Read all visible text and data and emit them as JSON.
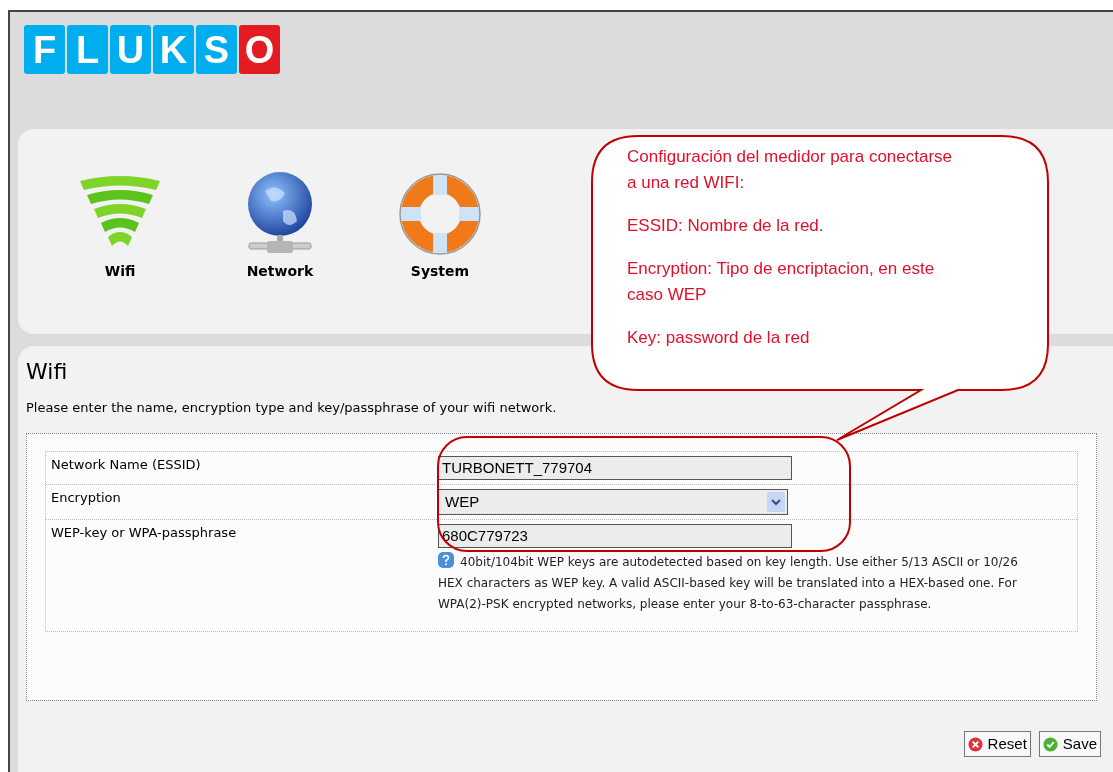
{
  "logo": {
    "letters": [
      {
        "char": "F",
        "color": "#00aeef"
      },
      {
        "char": "L",
        "color": "#00aeef"
      },
      {
        "char": "U",
        "color": "#00aeef"
      },
      {
        "char": "K",
        "color": "#00aeef"
      },
      {
        "char": "S",
        "color": "#00aeef"
      },
      {
        "char": "O",
        "color": "#e31b23"
      }
    ]
  },
  "nav": [
    {
      "kind": "wifi",
      "label": "Wifi"
    },
    {
      "kind": "network",
      "label": "Network"
    },
    {
      "kind": "system",
      "label": "System"
    }
  ],
  "section": {
    "title": "Wifi",
    "description": "Please enter the name, encryption type and key/passphrase of your wifi network."
  },
  "fields": [
    {
      "kind": "text",
      "label": "Network Name (ESSID)",
      "value": "TURBONETT_779704"
    },
    {
      "kind": "select",
      "label": "Encryption",
      "value": "WEP"
    },
    {
      "kind": "text",
      "label": "WEP-key or WPA-passphrase",
      "value": "680C779723",
      "help": "40bit/104bit WEP keys are autodetected based on key length. Use either 5/13 ASCII or 10/26 HEX characters as WEP key. A valid ASCII-based key will be translated into a HEX-based one. For WPA(2)-PSK encrypted networks, please enter your 8-to-63-character passphrase."
    }
  ],
  "buttons": [
    {
      "kind": "reset",
      "label": "Reset"
    },
    {
      "kind": "save",
      "label": "Save"
    }
  ],
  "callout": {
    "paragraphs": [
      "Configuración del medidor para conectarse a una red WIFI:",
      "ESSID: Nombre de la red.",
      "Encryption: Tipo de encriptacion, en este caso WEP",
      "Key: password de la red"
    ]
  }
}
